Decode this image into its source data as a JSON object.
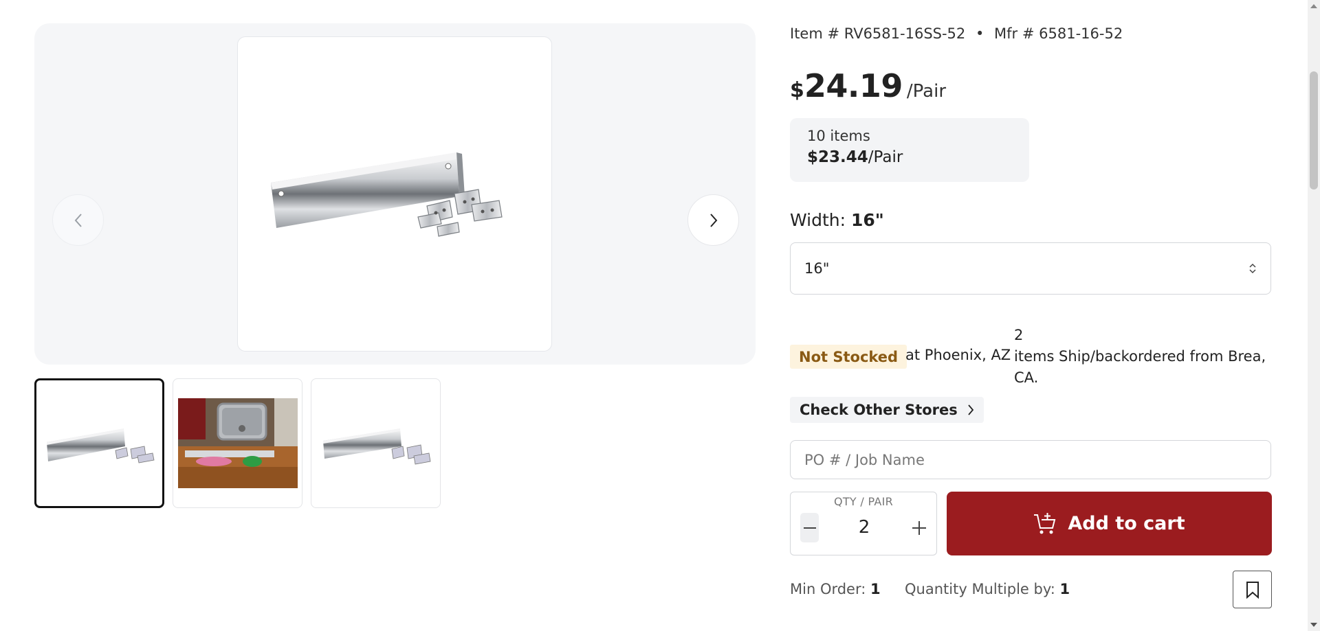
{
  "product": {
    "item_prefix": "Item #",
    "item_number": "RV6581-16SS-52",
    "bullet": "•",
    "mfr_prefix": "Mfr #",
    "mfr_number": "6581-16-52",
    "currency": "$",
    "price": "24.19",
    "unit": "/Pair"
  },
  "tier_pricing": {
    "quantity": "10 items",
    "price": "$23.44",
    "unit": "/Pair"
  },
  "width": {
    "label": "Width:",
    "selected": "16\"",
    "select_value": "16\""
  },
  "stock": {
    "badge": "Not Stocked",
    "location": "at Phoenix, AZ",
    "ship_count": "2",
    "ship_text": "items Ship/backordered from Brea, CA.",
    "badge_color": "#fdf3de"
  },
  "check_stores_label": "Check Other Stores",
  "po_input": {
    "placeholder": "PO # / Job Name",
    "value": ""
  },
  "quantity": {
    "label": "QTY / PAIR",
    "value": "2"
  },
  "add_to_cart_label": "Add to cart",
  "order_rules": {
    "min_label": "Min Order:",
    "min_value": "1",
    "multiple_label": "Quantity Multiple by:",
    "multiple_value": "1"
  },
  "gallery": {
    "thumbnail_count": 3,
    "active_index": 0
  },
  "colors": {
    "accent": "#9b1c1f",
    "gallery_bg": "#f5f6f8",
    "tier_bg": "#f3f4f6"
  }
}
